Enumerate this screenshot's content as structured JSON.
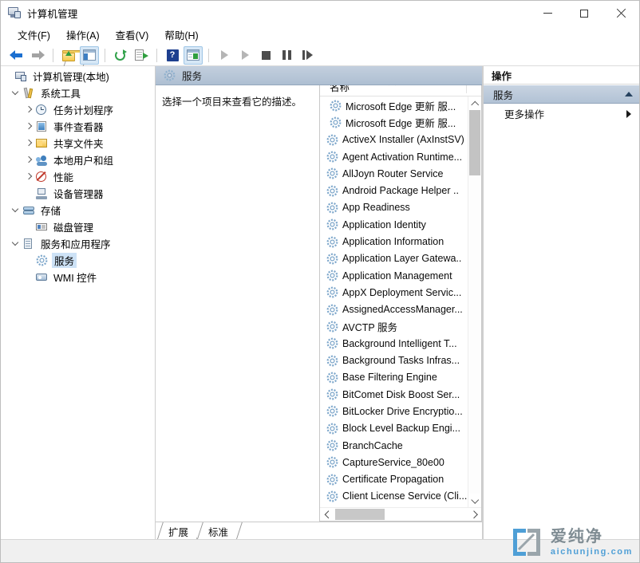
{
  "window": {
    "title": "计算机管理",
    "icon": "computer-management-icon",
    "controls": {
      "minimize": "—",
      "maximize": "□",
      "close": "✕"
    }
  },
  "menubar": {
    "items": [
      {
        "label": "文件(F)",
        "name": "menu-file"
      },
      {
        "label": "操作(A)",
        "name": "menu-action"
      },
      {
        "label": "查看(V)",
        "name": "menu-view"
      },
      {
        "label": "帮助(H)",
        "name": "menu-help"
      }
    ]
  },
  "toolbar": {
    "buttons": [
      {
        "name": "back-button",
        "icon": "arrow-left-icon",
        "enabled": true
      },
      {
        "name": "forward-button",
        "icon": "arrow-right-icon",
        "enabled": false
      },
      {
        "name": "up-one-level-button",
        "icon": "folder-up-icon",
        "enabled": true
      },
      {
        "name": "show-hide-tree-button",
        "icon": "console-tree-icon",
        "enabled": true
      },
      {
        "name": "refresh-button",
        "icon": "refresh-icon",
        "enabled": true
      },
      {
        "name": "export-list-button",
        "icon": "export-list-icon",
        "enabled": true
      },
      {
        "name": "help-button",
        "icon": "help-icon",
        "enabled": true
      },
      {
        "name": "properties-button",
        "icon": "properties-icon",
        "enabled": true
      },
      {
        "name": "start-service-button",
        "icon": "play-icon",
        "enabled": false
      },
      {
        "name": "resume-service-button",
        "icon": "play-icon",
        "enabled": false
      },
      {
        "name": "stop-service-button",
        "icon": "stop-icon",
        "enabled": false
      },
      {
        "name": "pause-service-button",
        "icon": "pause-icon",
        "enabled": false
      },
      {
        "name": "restart-service-button",
        "icon": "restart-icon",
        "enabled": false
      }
    ]
  },
  "tree": {
    "nodes": [
      {
        "label": "计算机管理(本地)",
        "level": 0,
        "expander": "none",
        "icon": "computer-icon",
        "selected": false
      },
      {
        "label": "系统工具",
        "level": 1,
        "expander": "expanded",
        "icon": "tools-icon",
        "selected": false
      },
      {
        "label": "任务计划程序",
        "level": 2,
        "expander": "collapsed",
        "icon": "clock-icon",
        "selected": false
      },
      {
        "label": "事件查看器",
        "level": 2,
        "expander": "collapsed",
        "icon": "event-viewer-icon",
        "selected": false
      },
      {
        "label": "共享文件夹",
        "level": 2,
        "expander": "collapsed",
        "icon": "shared-folder-icon",
        "selected": false
      },
      {
        "label": "本地用户和组",
        "level": 2,
        "expander": "collapsed",
        "icon": "users-icon",
        "selected": false
      },
      {
        "label": "性能",
        "level": 2,
        "expander": "collapsed",
        "icon": "performance-icon",
        "selected": false
      },
      {
        "label": "设备管理器",
        "level": 2,
        "expander": "none",
        "icon": "device-manager-icon",
        "selected": false
      },
      {
        "label": "存储",
        "level": 1,
        "expander": "expanded",
        "icon": "storage-icon",
        "selected": false
      },
      {
        "label": "磁盘管理",
        "level": 2,
        "expander": "none",
        "icon": "disk-management-icon",
        "selected": false
      },
      {
        "label": "服务和应用程序",
        "level": 1,
        "expander": "expanded",
        "icon": "services-apps-icon",
        "selected": false
      },
      {
        "label": "服务",
        "level": 2,
        "expander": "none",
        "icon": "service-gear-icon",
        "selected": true
      },
      {
        "label": "WMI 控件",
        "level": 2,
        "expander": "none",
        "icon": "wmi-control-icon",
        "selected": false
      }
    ]
  },
  "center": {
    "header_title": "服务",
    "header_icon": "service-gear-icon",
    "description": "选择一个项目来查看它的描述。",
    "column_header": "名称",
    "sort": "ascending",
    "services": [
      "Microsoft Edge 更新 服...",
      "Microsoft Edge 更新 服...",
      "ActiveX Installer (AxInstSV)",
      "Agent Activation Runtime...",
      "AllJoyn Router Service",
      "Android Package Helper ..",
      "App Readiness",
      "Application Identity",
      "Application Information",
      "Application Layer Gatewa..",
      "Application Management",
      "AppX Deployment Servic...",
      "AssignedAccessManager...",
      "AVCTP 服务",
      "Background Intelligent T...",
      "Background Tasks Infras...",
      "Base Filtering Engine",
      "BitComet Disk Boost Ser...",
      "BitLocker Drive Encryptio...",
      "Block Level Backup Engi...",
      "BranchCache",
      "CaptureService_80e00",
      "Certificate Propagation",
      "Client License Service (Cli..."
    ],
    "tabs": [
      {
        "label": "扩展",
        "name": "tab-extended",
        "active": false
      },
      {
        "label": "标准",
        "name": "tab-standard",
        "active": true
      }
    ]
  },
  "actions": {
    "title": "操作",
    "group_label": "服务",
    "items": [
      {
        "label": "更多操作",
        "name": "action-more-actions",
        "has_submenu": true
      }
    ]
  },
  "watermark": {
    "cn": "爱纯净",
    "en": "aichunjing.com",
    "logo_color": "#4f9fd6",
    "text_color": "#7f8c93"
  },
  "colors": {
    "header_bar": "#b7c5d6",
    "selection": "#cde2f6",
    "window_bg": "#ffffff",
    "status_bg": "#f0f0f0"
  }
}
